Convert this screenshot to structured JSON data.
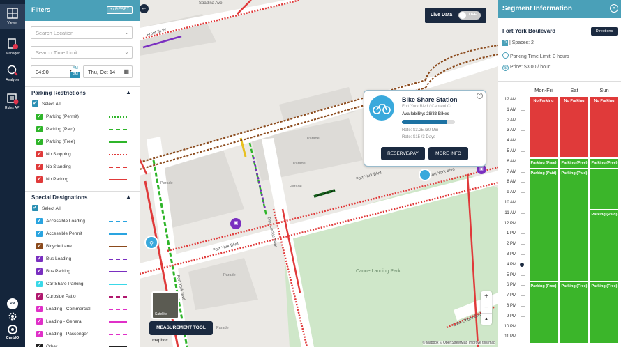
{
  "nav": {
    "items": [
      {
        "label": "Viewer"
      },
      {
        "label": "Manager"
      },
      {
        "label": "Analyzer"
      },
      {
        "label": "Rules API"
      }
    ],
    "user": "PM",
    "brand": "CurbIQ"
  },
  "filters": {
    "title": "Filters",
    "reset_label": "RESET",
    "search_location_placeholder": "Search Location",
    "search_time_placeholder": "Search Time Limit",
    "time_value": "04:00",
    "am": "AM",
    "pm": "PM",
    "date_value": "Thu, Oct 14",
    "parking_restrictions": {
      "title": "Parking Restrictions",
      "select_all": "Select All",
      "items": [
        {
          "label": "Parking (Permit)",
          "color": "#2fb52a"
        },
        {
          "label": "Parking (Paid)",
          "color": "#2fb52a"
        },
        {
          "label": "Parking (Free)",
          "color": "#2fb52a"
        },
        {
          "label": "No Stopping",
          "color": "#e03a3a"
        },
        {
          "label": "No Standing",
          "color": "#e03a3a"
        },
        {
          "label": "No Parking",
          "color": "#e03a3a"
        }
      ]
    },
    "special_designations": {
      "title": "Special Designations",
      "select_all": "Select All",
      "items": [
        {
          "label": "Accessible Loading",
          "color": "#2aa4e0"
        },
        {
          "label": "Accessible Permit",
          "color": "#2aa4e0"
        },
        {
          "label": "Bicycle Lane",
          "color": "#8b4a1c"
        },
        {
          "label": "Bus Loading",
          "color": "#7a2fc0"
        },
        {
          "label": "Bus Parking",
          "color": "#7a2fc0"
        },
        {
          "label": "Car Share Parking",
          "color": "#3ad8e8"
        },
        {
          "label": "Curbside Patio",
          "color": "#b0186e"
        },
        {
          "label": "Loading - Commercial",
          "color": "#e030c8"
        },
        {
          "label": "Loading - General",
          "color": "#e030c8"
        },
        {
          "label": "Loading - Passenger",
          "color": "#e030c8"
        },
        {
          "label": "Other",
          "color": "#222222"
        }
      ]
    }
  },
  "map": {
    "live_data_label": "Live Data",
    "live_data_state": "OFF",
    "street_labels": [
      "Front St W",
      "Fort York Blvd",
      "Fort York Blvd",
      "Fort York Blvd",
      "Dan Leckie Way",
      "Fort York Blvd",
      "Spadina Ave",
      "Lake Shore Blvd W"
    ],
    "area_labels": [
      "Parade",
      "Parade",
      "Parade",
      "Parade",
      "Parade",
      "Parade",
      "Canoe Landing Park"
    ],
    "popup": {
      "title": "Bike Share Station",
      "subtitle": "Fort York Blvd / Capreol Ct",
      "availability": "Availability: 28/33 Bikes",
      "availability_fraction": 0.85,
      "rate1": "Rate: $3.25 /30 Min",
      "rate2": "Rate: $15 /3 Days",
      "reserve_label": "RESERVE/PAY",
      "more_label": "MORE INFO"
    },
    "satellite_label": "Satellite",
    "measurement_tool_label": "MEASUREMENT TOOL",
    "zoom_in": "+",
    "zoom_out": "−",
    "compass": "▲",
    "attribution": "© Mapbox © OpenStreetMap Improve this map",
    "mapbox_logo": "mapbox"
  },
  "segment": {
    "title": "Segment Information",
    "street": "Fort York Boulevard",
    "directions_label": "Directions",
    "spaces": "| Spaces: 2",
    "time_limit": "Parking Time Limit: 3 hours",
    "price": "Price: $3.00 / hour",
    "days": [
      "Mon-Fri",
      "Sat",
      "Sun"
    ],
    "hours": [
      "12 AM",
      "1 AM",
      "2 AM",
      "3 AM",
      "4 AM",
      "5 AM",
      "6 AM",
      "7 AM",
      "8 AM",
      "9 AM",
      "10 AM",
      "11 AM",
      "12 PM",
      "1 PM",
      "2 PM",
      "3 PM",
      "4 PM",
      "5 PM",
      "6 PM",
      "7 PM",
      "8 PM",
      "9 PM",
      "10 PM",
      "11 PM"
    ],
    "blocks": [
      {
        "day": 0,
        "start": 0,
        "end": 6,
        "label": "No Parking",
        "kind": "red"
      },
      {
        "day": 1,
        "start": 0,
        "end": 6,
        "label": "No Parking",
        "kind": "red"
      },
      {
        "day": 2,
        "start": 0,
        "end": 6,
        "label": "No Parking",
        "kind": "red"
      },
      {
        "day": 0,
        "start": 6,
        "end": 7,
        "label": "Parking (Free)",
        "kind": "green"
      },
      {
        "day": 1,
        "start": 6,
        "end": 7,
        "label": "Parking (Free)",
        "kind": "green"
      },
      {
        "day": 2,
        "start": 6,
        "end": 7,
        "label": "Parking (Free)",
        "kind": "green"
      },
      {
        "day": 0,
        "start": 7,
        "end": 18,
        "label": "Parking (Paid)",
        "kind": "green"
      },
      {
        "day": 1,
        "start": 7,
        "end": 18,
        "label": "Parking (Paid)",
        "kind": "green"
      },
      {
        "day": 2,
        "start": 7,
        "end": 11,
        "label": "",
        "kind": "green"
      },
      {
        "day": 2,
        "start": 11,
        "end": 18,
        "label": "Parking (Paid)",
        "kind": "green"
      },
      {
        "day": 0,
        "start": 18,
        "end": 24,
        "label": "Parking (Free)",
        "kind": "green"
      },
      {
        "day": 1,
        "start": 18,
        "end": 24,
        "label": "Parking (Free)",
        "kind": "green"
      },
      {
        "day": 2,
        "start": 18,
        "end": 24,
        "label": "Parking (Free)",
        "kind": "green"
      }
    ],
    "current_hour": 16
  }
}
